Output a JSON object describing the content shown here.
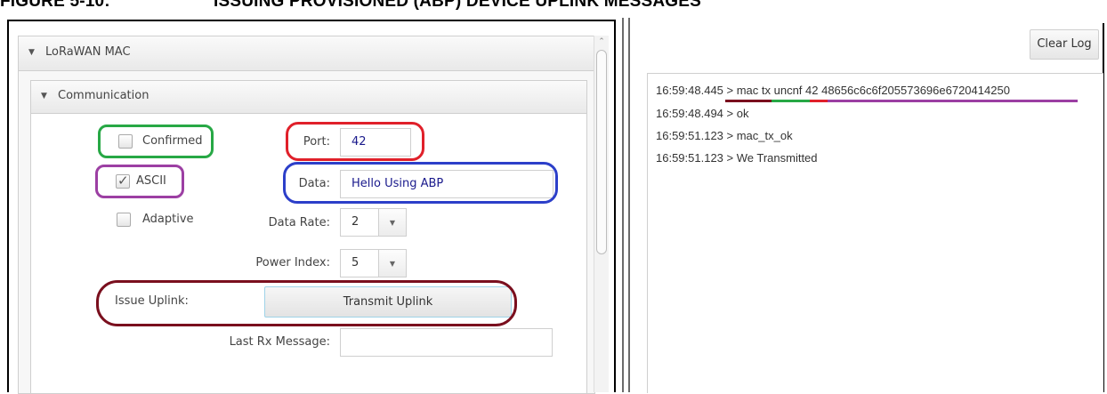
{
  "figure": {
    "number": "FIGURE 5-10:",
    "title": "ISSUING PROVISIONED (ABP) DEVICE UPLINK MESSAGES"
  },
  "panel": {
    "section_title": "LoRaWAN MAC",
    "subsection_title": "Communication",
    "confirmed": {
      "label": "Confirmed",
      "checked": false
    },
    "ascii": {
      "label": "ASCII",
      "checked": true
    },
    "adaptive": {
      "label": "Adaptive",
      "checked": false
    },
    "port": {
      "label": "Port:",
      "value": "42"
    },
    "data": {
      "label": "Data:",
      "value": "Hello Using ABP"
    },
    "data_rate": {
      "label": "Data Rate:",
      "value": "2"
    },
    "power_index": {
      "label": "Power Index:",
      "value": "5"
    },
    "issue_uplink": {
      "label": "Issue Uplink:",
      "button_label": "Transmit Uplink"
    },
    "last_rx": {
      "label": "Last Rx Message:",
      "value": ""
    }
  },
  "log": {
    "clear_label": "Clear Log",
    "lines": [
      "16:59:48.445 > mac tx uncnf 42 48656c6c6f205573696e6720414250",
      "16:59:48.494 > ok",
      "16:59:51.123 > mac_tx_ok",
      "16:59:51.123 > We Transmitted"
    ]
  },
  "colors": {
    "annotation_green": "#27a845",
    "annotation_purple": "#9c3fa3",
    "annotation_red": "#e0202a",
    "annotation_blue": "#2c3fc9",
    "annotation_maroon": "#7a0f1e",
    "button_highlight": "#9fd3e8"
  },
  "icons": {
    "section_caret": "triangle-down-icon",
    "dropdown_arrow": "chevron-down-icon",
    "scroll_up": "chevron-up-icon",
    "checkmark": "checkmark-icon"
  }
}
